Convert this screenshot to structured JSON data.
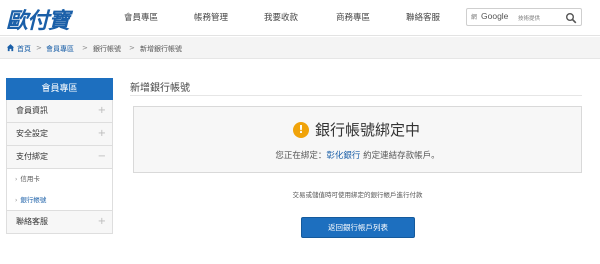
{
  "brand": {
    "logo_text": "歐付寶",
    "color": "#1a5fa8"
  },
  "nav": {
    "items": [
      "會員專區",
      "帳務管理",
      "我要收款",
      "商務專區",
      "聯絡客服"
    ]
  },
  "search": {
    "brand_small": "網",
    "google_text": "Google",
    "sub_text": "技術提供"
  },
  "breadcrumb": {
    "items": [
      "首頁",
      "會員專區",
      "銀行帳號",
      "新增銀行帳號"
    ],
    "separator": ">"
  },
  "sidebar": {
    "title": "會員專區",
    "items": [
      {
        "label": "會員資訊",
        "toggle": "+"
      },
      {
        "label": "安全設定",
        "toggle": "+"
      },
      {
        "label": "支付綁定",
        "toggle": "−"
      }
    ],
    "sub_items": [
      "信用卡",
      "銀行帳號"
    ],
    "bottom_item": {
      "label": "聯絡客服",
      "toggle": "+"
    },
    "accent": "#1d6fbf"
  },
  "main": {
    "title": "新增銀行帳號",
    "notice": {
      "icon": "exclamation-circle-icon",
      "heading": "銀行帳號綁定中",
      "line_prefix": "您正在綁定：",
      "bank_name": "彰化銀行",
      "line_suffix": " 約定連結存款帳戶。"
    },
    "footnote": "交易或儲值時可使用綁定的銀行帳戶進行付款",
    "back_button": "返回銀行帳戶列表"
  }
}
